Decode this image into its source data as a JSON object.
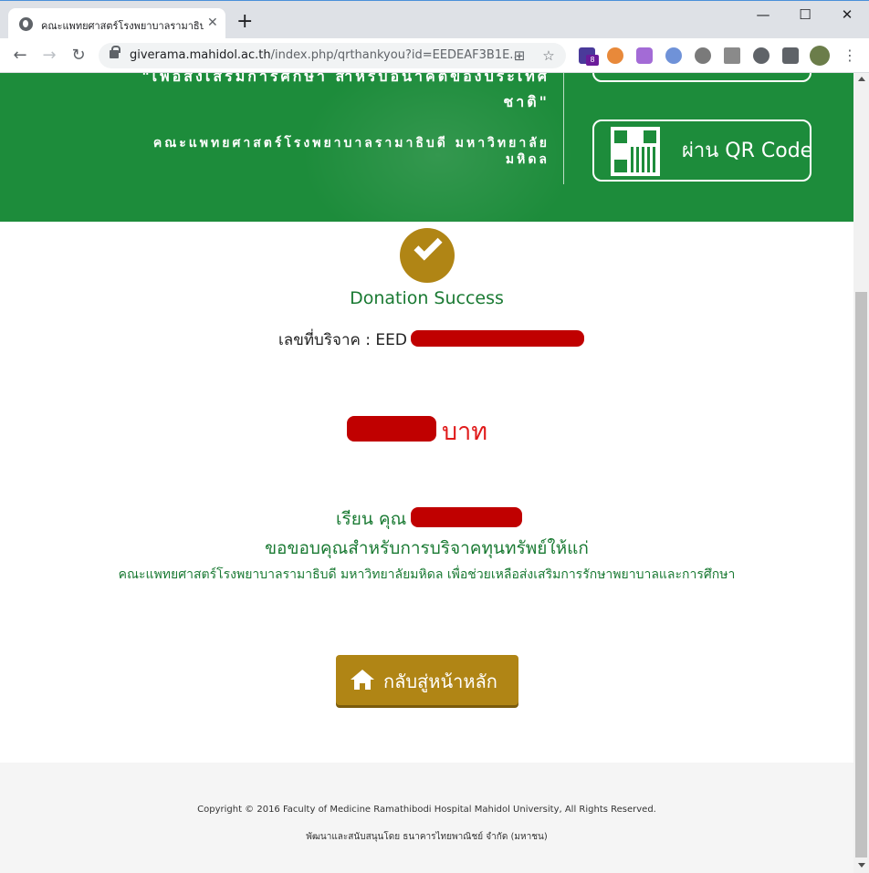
{
  "browser": {
    "tab_title": "คณะแพทยศาสตร์โรงพยาบาลรามาธิบดี",
    "tab_close": "✕",
    "new_tab": "+",
    "url_host": "giverama.mahidol.ac.th",
    "url_path": "/index.php/qrthankyou?id=EEDEAF3B1E...",
    "extension_badge": "8",
    "window_controls": [
      "—",
      "☐",
      "✕"
    ]
  },
  "banner": {
    "line1": "\"เพื่อส่งเสริมการศึกษา สำหรับอนาคตของประเทศ",
    "line2": "ชาติ\"",
    "line3": "คณะแพทยศาสตร์โรงพยาบาลรามาธิบดี มหาวิทยาลัยมหิดล",
    "qr_button_label": "ผ่าน QR Code"
  },
  "main": {
    "success_title": "Donation Success",
    "ref_label": "เลขที่บริจาค : EED",
    "amount_unit": "บาท",
    "dear_label": "เรียน คุณ",
    "thanks_text": "ขอขอบคุณสำหรับการบริจาคทุนทรัพย์ให้แก่",
    "note_text": "คณะแพทยศาสตร์โรงพยาบาลรามาธิบดี มหาวิทยาลัยมหิดล เพื่อช่วยเหลือส่งเสริมการรักษาพยาบาลและการศึกษา",
    "home_button_label": "กลับสู่หน้าหลัก"
  },
  "footer": {
    "copyright": "Copyright © 2016 Faculty of Medicine Ramathibodi Hospital Mahidol University, All Rights Reserved.",
    "developer": "พัฒนาและสนับสนุนโดย ธนาคารไทยพาณิชย์ จำกัด (มหาชน)"
  },
  "colors": {
    "banner_green": "#1d8c3b",
    "text_green": "#1a7a33",
    "gold": "#b08515",
    "amount_red": "#e01b1b",
    "redaction_red": "#c00000"
  }
}
